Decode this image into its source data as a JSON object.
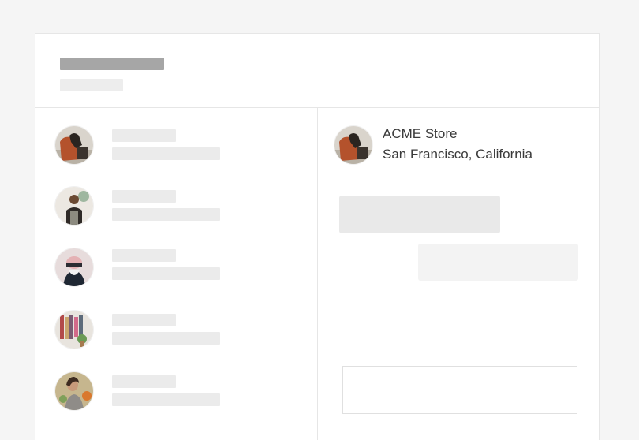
{
  "store": {
    "name": "ACME Store",
    "location": "San Francisco, California"
  },
  "colors": {
    "skeleton_dark": "#a6a6a6",
    "skeleton_light": "#e9e9e9",
    "skeleton_lighter": "#f2f2f2",
    "border": "#e6e6e6",
    "text": "#3a3a3a"
  },
  "conversations": [
    {
      "avatar": "store-photo-avatar"
    },
    {
      "avatar": "craftsman-avatar"
    },
    {
      "avatar": "masked-person-avatar"
    },
    {
      "avatar": "clothing-rack-avatar"
    },
    {
      "avatar": "woman-portrait-avatar"
    }
  ]
}
